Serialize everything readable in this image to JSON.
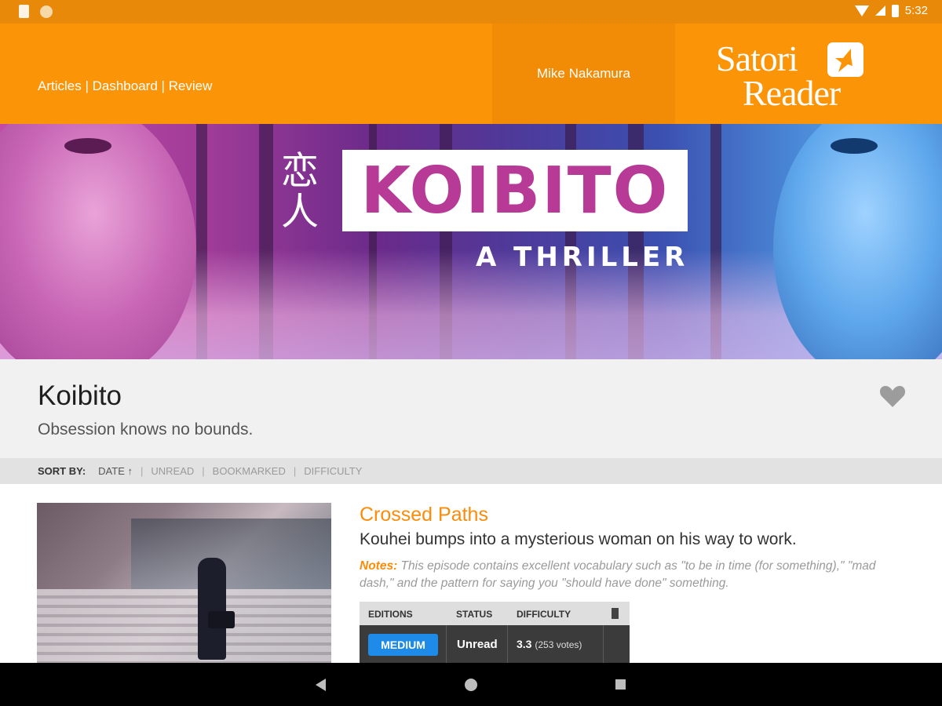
{
  "status_bar": {
    "time": "5:32"
  },
  "header": {
    "nav": {
      "articles": "Articles",
      "dashboard": "Dashboard",
      "review": "Review",
      "separator": " | "
    },
    "user_name": "Mike Nakamura",
    "logo": {
      "line1": "Satori",
      "line2": "Reader"
    }
  },
  "banner": {
    "kanji": "恋人",
    "title": "KOIBITO",
    "subtitle": "A THRILLER"
  },
  "series": {
    "name": "Koibito",
    "tagline": "Obsession knows no bounds."
  },
  "sort": {
    "label": "SORT BY:",
    "options": [
      "DATE ↑",
      "UNREAD",
      "BOOKMARKED",
      "DIFFICULTY"
    ],
    "separator": "|"
  },
  "episode": {
    "title": "Crossed Paths",
    "subtitle": "Kouhei bumps into a mysterious woman on his way to work.",
    "notes_label": "Notes:",
    "notes_text": " This episode contains excellent vocabulary such as \"to be in time (for something),\" \"mad dash,\" and the pattern for saying you \"should have done\" something.",
    "table": {
      "headers": {
        "editions": "EDITIONS",
        "status": "STATUS",
        "difficulty": "DIFFICULTY"
      },
      "edition": "MEDIUM",
      "status": "Unread",
      "difficulty_value": "3.3",
      "difficulty_votes": "(253 votes)"
    }
  },
  "colors": {
    "brand_orange": "#fb9406",
    "accent_blue": "#1f8be8",
    "title_orange": "#fb8c0a"
  }
}
